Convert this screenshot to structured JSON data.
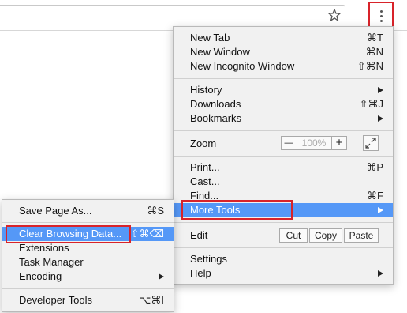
{
  "main_menu": {
    "items": [
      {
        "label": "New Tab",
        "shortcut": "⌘T"
      },
      {
        "label": "New Window",
        "shortcut": "⌘N"
      },
      {
        "label": "New Incognito Window",
        "shortcut": "⇧⌘N"
      },
      {
        "label": "History"
      },
      {
        "label": "Downloads",
        "shortcut": "⇧⌘J"
      },
      {
        "label": "Bookmarks"
      },
      {
        "label": "Zoom"
      },
      {
        "label": "Print...",
        "shortcut": "⌘P"
      },
      {
        "label": "Cast..."
      },
      {
        "label": "Find...",
        "shortcut": "⌘F"
      },
      {
        "label": "More Tools"
      },
      {
        "label": "Edit"
      },
      {
        "label": "Settings"
      },
      {
        "label": "Help"
      }
    ],
    "zoom": {
      "minus": "—",
      "value": "100%",
      "plus": "+"
    },
    "edit": {
      "cut": "Cut",
      "copy": "Copy",
      "paste": "Paste"
    }
  },
  "submenu": {
    "items": [
      {
        "label": "Save Page As...",
        "shortcut": "⌘S"
      },
      {
        "label": "Clear Browsing Data...",
        "shortcut": "⇧⌘⌫"
      },
      {
        "label": "Extensions"
      },
      {
        "label": "Task Manager"
      },
      {
        "label": "Encoding"
      },
      {
        "label": "Developer Tools",
        "shortcut": "⌥⌘I"
      }
    ]
  },
  "colors": {
    "highlight": "#5598f7",
    "callout": "#d8232a"
  },
  "icons": [
    "star-icon",
    "more-vert-icon",
    "fullscreen-icon",
    "submenu-arrow-icon"
  ]
}
